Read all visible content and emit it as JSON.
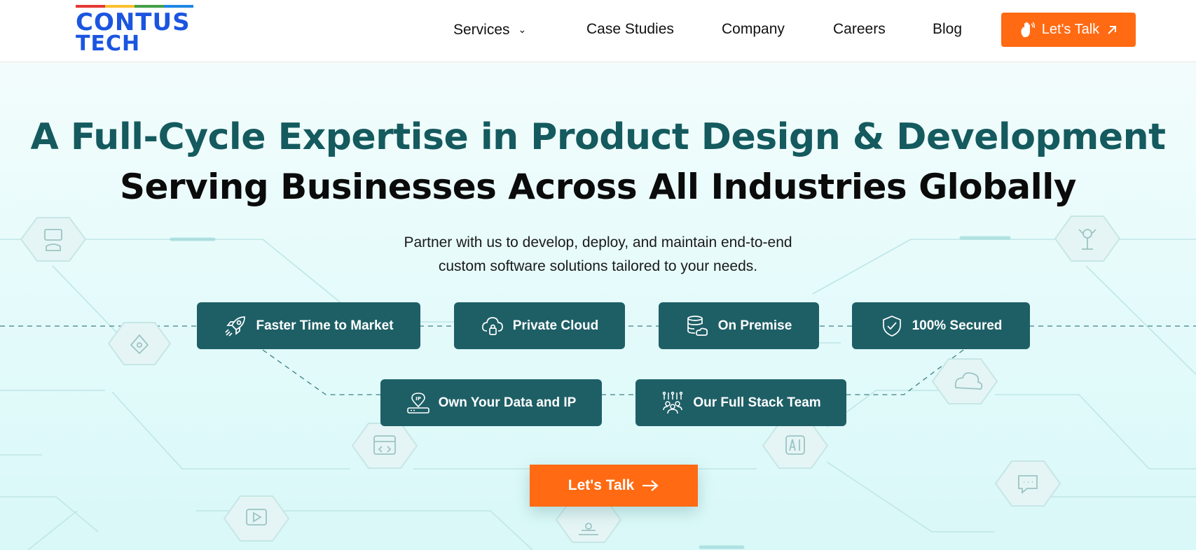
{
  "brand": {
    "logo_line1": "CONTUS",
    "logo_line2": "TECH",
    "logo_color": "#1b55e0",
    "logo_stripe_colors": [
      "#e53935",
      "#fbc02d",
      "#43a047",
      "#1e88e5"
    ]
  },
  "nav": {
    "items": [
      {
        "label": "Services",
        "has_dropdown": true
      },
      {
        "label": "Case Studies"
      },
      {
        "label": "Company"
      },
      {
        "label": "Careers"
      },
      {
        "label": "Blog"
      }
    ],
    "cta_label": "Let's Talk",
    "cta_icons": [
      "waving-hand-icon",
      "arrow-up-right-icon"
    ]
  },
  "hero": {
    "headline_line1": "A Full-Cycle Expertise in Product Design & Development",
    "headline_line2": "Serving Businesses Across All Industries Globally",
    "subtitle_line1": "Partner with us to develop, deploy, and maintain end-to-end",
    "subtitle_line2": "custom software solutions tailored to your needs.",
    "features": [
      {
        "label": "Faster Time to Market",
        "icon": "rocket-icon"
      },
      {
        "label": "Private Cloud",
        "icon": "cloud-lock-icon"
      },
      {
        "label": "On Premise",
        "icon": "server-database-icon"
      },
      {
        "label": "100% Secured",
        "icon": "shield-check-icon"
      },
      {
        "label": "Own Your Data and IP",
        "icon": "ip-location-icon"
      },
      {
        "label": "Our Full Stack Team",
        "icon": "team-network-icon"
      }
    ],
    "cta_label": "Let's Talk",
    "background_icons": [
      "monitor-hand-icon",
      "pen-tool-icon",
      "code-window-icon",
      "play-video-icon",
      "drone-icon",
      "ai-chip-icon",
      "cloud-icon",
      "chat-bubble-icon",
      "robot-arm-icon"
    ]
  },
  "colors": {
    "accent_orange": "#ff6a13",
    "teal_dark": "#1e5f66",
    "headline_teal": "#145a5e",
    "hero_background": "#e6fbfb"
  }
}
